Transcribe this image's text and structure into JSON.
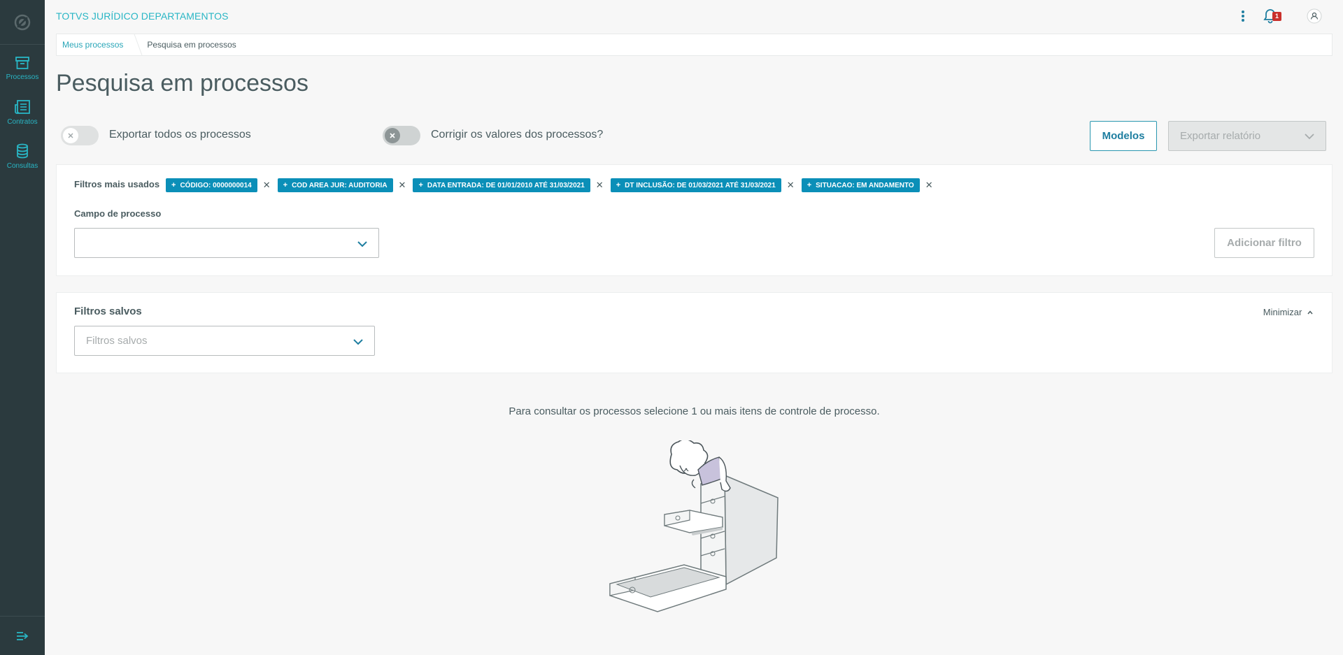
{
  "header": {
    "app_title": "TOTVS JURÍDICO DEPARTAMENTOS",
    "notification_count": "1"
  },
  "sidebar": {
    "items": [
      {
        "label": "Processos",
        "icon": "archive-box-icon"
      },
      {
        "label": "Contratos",
        "icon": "document-list-icon"
      },
      {
        "label": "Consultas",
        "icon": "database-icon"
      }
    ]
  },
  "breadcrumb": {
    "link": "Meus processos",
    "current": "Pesquisa em processos"
  },
  "page": {
    "title": "Pesquisa em processos"
  },
  "toolbar": {
    "toggle_export_all": "Exportar todos os processos",
    "toggle_correct_values": "Corrigir os valores dos processos?",
    "modelos_label": "Modelos",
    "export_report_label": "Exportar relatório"
  },
  "filters": {
    "most_used_label": "Filtros mais usados",
    "chips": [
      "CÓDIGO: 0000000014",
      "COD AREA JUR: AUDITORIA",
      "DATA ENTRADA: DE 01/01/2010 ATÉ 31/03/2021",
      "DT INCLUSÃO: DE 01/03/2021 ATÉ 31/03/2021",
      "SITUACAO: EM ANDAMENTO"
    ],
    "campo_label": "Campo de processo",
    "campo_value": "",
    "add_filter_label": "Adicionar filtro"
  },
  "saved_filters": {
    "title": "Filtros salvos",
    "minimize_label": "Minimizar",
    "select_placeholder": "Filtros salvos"
  },
  "empty_state": {
    "message": "Para consultar os processos selecione 1 ou mais itens de controle de processo."
  },
  "colors": {
    "sidebar_bg": "#2b3a3e",
    "accent": "#29b6c5",
    "chip_bg": "#0b8fb8",
    "primary_text": "#4a5c60"
  }
}
